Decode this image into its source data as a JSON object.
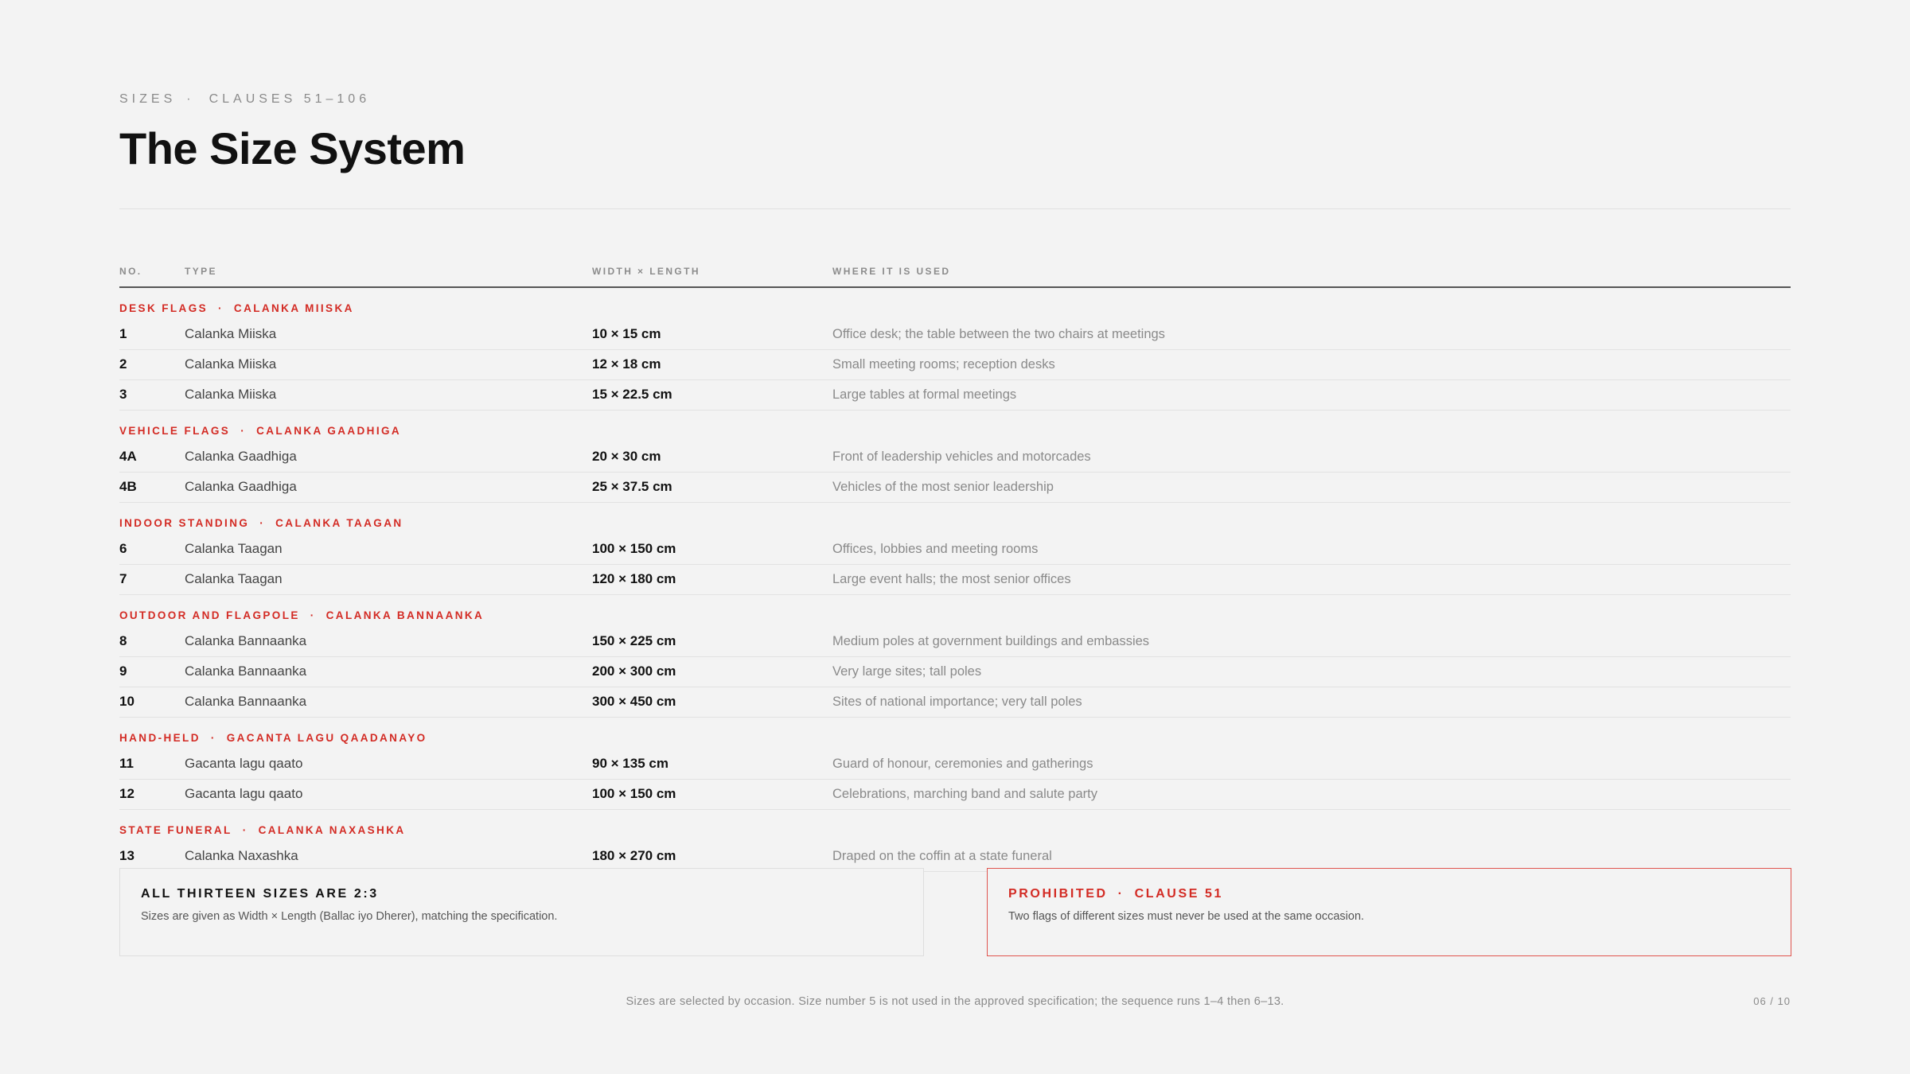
{
  "header": {
    "section": "SIZES",
    "separator": "·",
    "clauses": "CLAUSES 51–106",
    "title": "The Size System"
  },
  "table": {
    "columns": [
      "NO.",
      "TYPE",
      "WIDTH × LENGTH",
      "WHERE IT IS USED"
    ],
    "groups": [
      {
        "label": "DESK FLAGS",
        "sublabel": "CALANKA MIISKA",
        "rows": [
          {
            "no": "1",
            "type": "Calanka Miiska",
            "size": "10 × 15 cm",
            "where": "Office desk; the table between the two chairs at meetings"
          },
          {
            "no": "2",
            "type": "Calanka Miiska",
            "size": "12 × 18 cm",
            "where": "Small meeting rooms; reception desks"
          },
          {
            "no": "3",
            "type": "Calanka Miiska",
            "size": "15 × 22.5 cm",
            "where": "Large tables at formal meetings"
          }
        ]
      },
      {
        "label": "VEHICLE FLAGS",
        "sublabel": "CALANKA GAADHIGA",
        "rows": [
          {
            "no": "4A",
            "type": "Calanka Gaadhiga",
            "size": "20 × 30 cm",
            "where": "Front of leadership vehicles and motorcades"
          },
          {
            "no": "4B",
            "type": "Calanka Gaadhiga",
            "size": "25 × 37.5 cm",
            "where": "Vehicles of the most senior leadership"
          }
        ]
      },
      {
        "label": "INDOOR STANDING",
        "sublabel": "CALANKA TAAGAN",
        "rows": [
          {
            "no": "6",
            "type": "Calanka Taagan",
            "size": "100 × 150 cm",
            "where": "Offices, lobbies and meeting rooms"
          },
          {
            "no": "7",
            "type": "Calanka Taagan",
            "size": "120 × 180 cm",
            "where": "Large event halls; the most senior offices"
          }
        ]
      },
      {
        "label": "OUTDOOR AND FLAGPOLE",
        "sublabel": "CALANKA BANNAANKA",
        "rows": [
          {
            "no": "8",
            "type": "Calanka Bannaanka",
            "size": "150 × 225 cm",
            "where": "Medium poles at government buildings and embassies"
          },
          {
            "no": "9",
            "type": "Calanka Bannaanka",
            "size": "200 × 300 cm",
            "where": "Very large sites; tall poles"
          },
          {
            "no": "10",
            "type": "Calanka Bannaanka",
            "size": "300 × 450 cm",
            "where": "Sites of national importance; very tall poles"
          }
        ]
      },
      {
        "label": "HAND-HELD",
        "sublabel": "GACANTA LAGU QAADANAYO",
        "rows": [
          {
            "no": "11",
            "type": "Gacanta lagu qaato",
            "size": "90 × 135 cm",
            "where": "Guard of honour, ceremonies and gatherings"
          },
          {
            "no": "12",
            "type": "Gacanta lagu qaato",
            "size": "100 × 150 cm",
            "where": "Celebrations, marching band and salute party"
          }
        ]
      },
      {
        "label": "STATE FUNERAL",
        "sublabel": "CALANKA NAXASHKA",
        "rows": [
          {
            "no": "13",
            "type": "Calanka Naxashka",
            "size": "180 × 270 cm",
            "where": "Draped on the coffin at a state funeral"
          }
        ]
      }
    ]
  },
  "note_box": {
    "title": "ALL THIRTEEN SIZES ARE 2:3",
    "text": "Sizes are given as Width × Length (Ballac iyo Dherer), matching the specification."
  },
  "warn_box": {
    "title": "PROHIBITED",
    "clause": "CLAUSE 51",
    "text": "Two flags of different sizes must never be used at the same occasion."
  },
  "footer": {
    "text": "Sizes are selected by occasion. Size number 5 is not used in the approved specification; the sequence runs 1–4 then 6–13.",
    "page": "06 / 10"
  },
  "colors": {
    "accent": "#d32b24",
    "background": "#f3f3f3",
    "text": "#111111",
    "muted": "#8a8a8a"
  }
}
